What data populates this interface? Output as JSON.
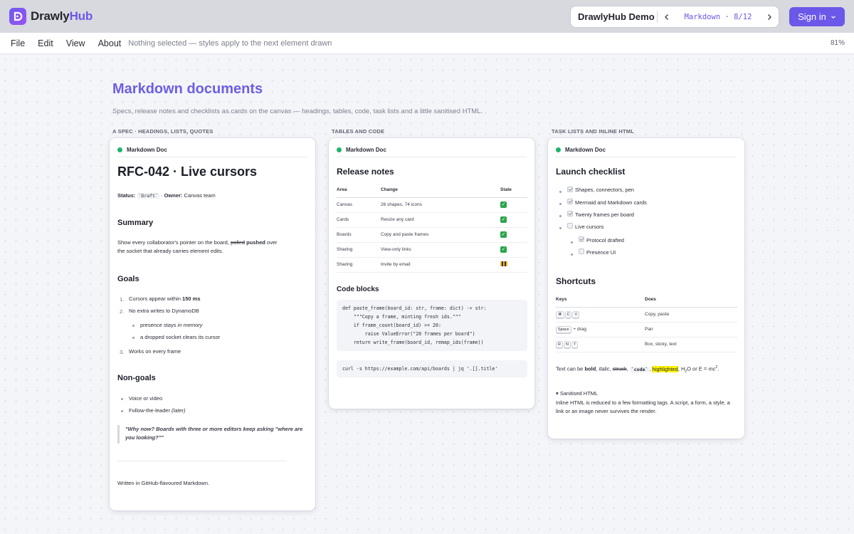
{
  "app": {
    "brand_prefix": "Drawly",
    "brand_suffix": "Hub",
    "demo_title": "DrawlyHub Demo",
    "pager_label": "Markdown · 8/12",
    "signin_label": "Sign in"
  },
  "menu": {
    "items": [
      "File",
      "Edit",
      "View",
      "About"
    ],
    "status": "Nothing selected — styles apply to the next element drawn",
    "zoom": "81%"
  },
  "page": {
    "title": "Markdown documents",
    "subtitle": "Specs, release notes and checklists as cards on the canvas — headings, tables, code, task lists and a little sanitised HTML.",
    "columns": [
      "A SPEC · HEADINGS, LISTS, QUOTES",
      "TABLES AND CODE",
      "TASK LISTS AND INLINE HTML"
    ]
  },
  "card_label": "Markdown Doc",
  "spec": {
    "title": "RFC-042 · Live cursors",
    "status_label": "Status:",
    "status_value": "`Draft`",
    "owner_sep": " · ",
    "owner_label": "Owner:",
    "owner_value": "Canvas team",
    "summary_heading": "Summary",
    "summary_a": "Show every collaborator's pointer on the board,",
    "summary_strike": "polled",
    "summary_bold": "pushed",
    "summary_b": "over",
    "summary_c": "the socket that already carries element edits.",
    "goals_heading": "Goals",
    "goal1_a": "Cursors appear within",
    "goal1_b": "150 ms",
    "goal2": "No extra writes to DynamoDB",
    "sub1_a": "presence stays",
    "sub1_b": "in memory",
    "sub2": "a dropped socket clears its cursor",
    "goal3": "Works on every frame",
    "nongoals_heading": "Non-goals",
    "ng1": "Voice or video",
    "ng2_a": "Follow-the-leader",
    "ng2_b": "(later)",
    "quote": "\"Why now? Boards with three or more editors keep asking \"where are you looking?\"\"",
    "footer": "Written in GitHub-flavoured Markdown."
  },
  "release": {
    "title": "Release notes",
    "headers": [
      "Area",
      "Change",
      "State"
    ],
    "rows": [
      {
        "area": "Canvas",
        "change": "26 shapes, 74 icons",
        "state": "done"
      },
      {
        "area": "Cards",
        "change": "Resize any card",
        "state": "done"
      },
      {
        "area": "Boards",
        "change": "Copy and paste frames",
        "state": "done"
      },
      {
        "area": "Sharing",
        "change": "View-only links",
        "state": "done"
      },
      {
        "area": "Sharing",
        "change": "Invite by email",
        "state": "in-progress"
      }
    ],
    "code_heading": "Code blocks",
    "code_python": "def paste_frame(board_id: str, frame: dict) -> str:\n    \"\"\"Copy a frame, minting fresh ids.\"\"\"\n    if frame_count(board_id) >= 20:\n        raise ValueError(\"20 frames per board\")\n    return write_frame(board_id, remap_ids(frame))",
    "code_shell": "curl -s https://example.com/api/boards | jq '.[].title'"
  },
  "checklist": {
    "title": "Launch checklist",
    "tasks": [
      {
        "label": "Shapes, connectors, pen",
        "checked": true
      },
      {
        "label": "Mermaid and Markdown cards",
        "checked": true
      },
      {
        "label": "Twenty frames per board",
        "checked": true
      },
      {
        "label": "Live cursors",
        "checked": false
      }
    ],
    "subtasks": [
      {
        "label": "Protocol drafted",
        "checked": true
      },
      {
        "label": "Presence UI",
        "checked": false
      }
    ],
    "shortcuts_heading": "Shortcuts",
    "shortcut_headers": [
      "Keys",
      "Does"
    ],
    "shortcuts": [
      {
        "keys": [
          "⌘",
          "C",
          "V"
        ],
        "suffix": "",
        "does": "Copy, paste"
      },
      {
        "keys": [
          "Space"
        ],
        "suffix": "+ drag",
        "does": "Pan"
      },
      {
        "keys": [
          "R",
          "N",
          "T"
        ],
        "suffix": "",
        "does": "Box, sticky, text"
      }
    ],
    "inline_a": "Text can be",
    "inline_bold": "bold",
    "inline_ital": "italic",
    "inline_strike": "struck",
    "inline_code": "`code`",
    "inline_hl": "highlighted",
    "inline_b": "H",
    "inline_sub": "2",
    "inline_c": "O or E =",
    "inline_d": "mc",
    "inline_sup": "2",
    "details_summary": "Sanitised HTML",
    "details_body": "Inline HTML is reduced to a few formatting tags. A script, a form, a style, a link or an image never survives the render."
  }
}
